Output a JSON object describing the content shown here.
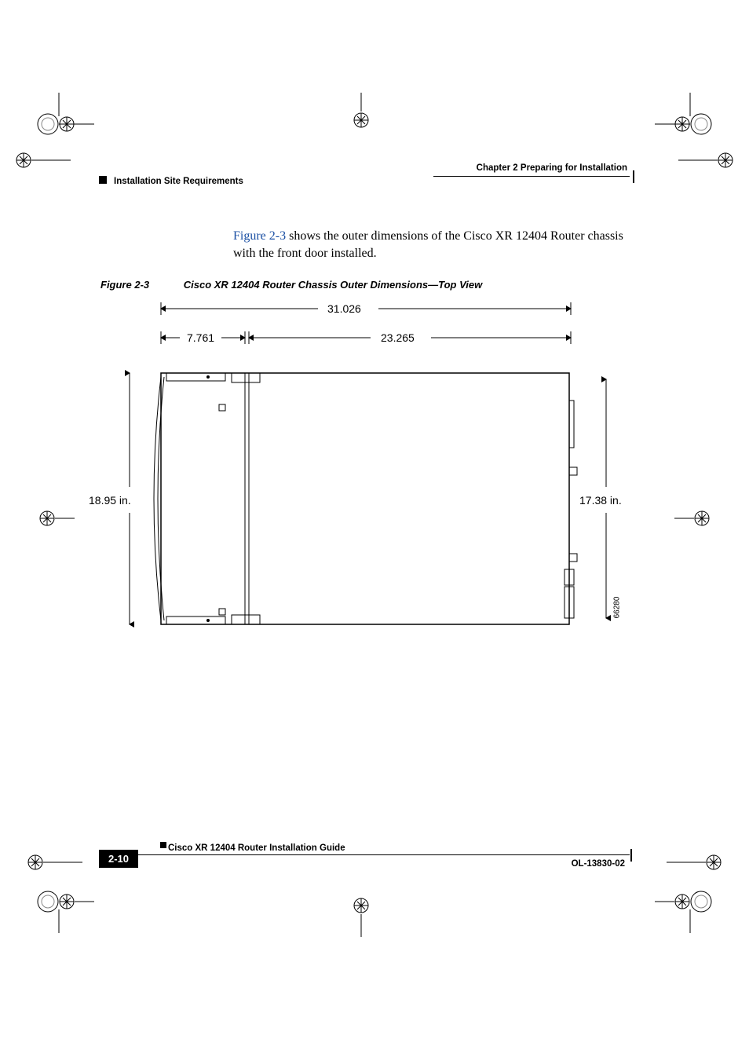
{
  "header": {
    "chapter": "Chapter 2    Preparing for Installation",
    "section": "Installation Site Requirements"
  },
  "body": {
    "figref": "Figure 2-3",
    "para_rest": " shows the outer dimensions of the Cisco XR 12404 Router chassis with the front door installed."
  },
  "figure": {
    "number": "Figure 2-3",
    "title": "Cisco XR 12404 Router Chassis Outer Dimensions—Top View",
    "dims": {
      "total_width": "31.026",
      "front_depth": "7.761",
      "rear_depth": "23.265",
      "left_height": "18.95 in.",
      "right_height": "17.38 in."
    },
    "drawing_id": "66280"
  },
  "footer": {
    "doc_title": "Cisco XR 12404 Router Installation Guide",
    "page": "2-10",
    "doc_id": "OL-13830-02"
  }
}
